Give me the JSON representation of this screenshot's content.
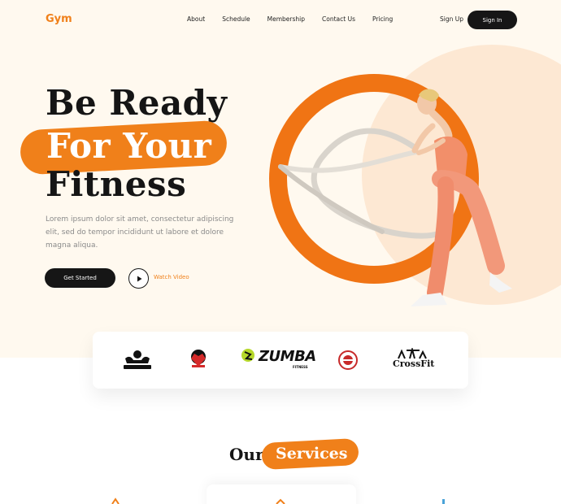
{
  "brand": {
    "logo": "Gym",
    "accent": "#f0801a",
    "dark": "#161616"
  },
  "nav": {
    "items": [
      "About",
      "Schedule",
      "Membership",
      "Contact Us",
      "Pricing"
    ],
    "sign_up": "Sign Up",
    "sign_in": "Sign In"
  },
  "hero": {
    "line1": "Be Ready",
    "line2": "For Your",
    "line3": "Fitness",
    "description": "Lorem ipsum dolor sit amet, consectetur adipiscing elit, sed do tempor incididunt ut labore et dolore magna aliqua.",
    "cta": "Get Started",
    "watch": "Watch Video"
  },
  "partners": {
    "zumba": "ZUMBA",
    "zumba_sub": "FITNESS",
    "crossfit": "CrossFit"
  },
  "services": {
    "title_word1": "Our",
    "title_word2": "Services"
  }
}
